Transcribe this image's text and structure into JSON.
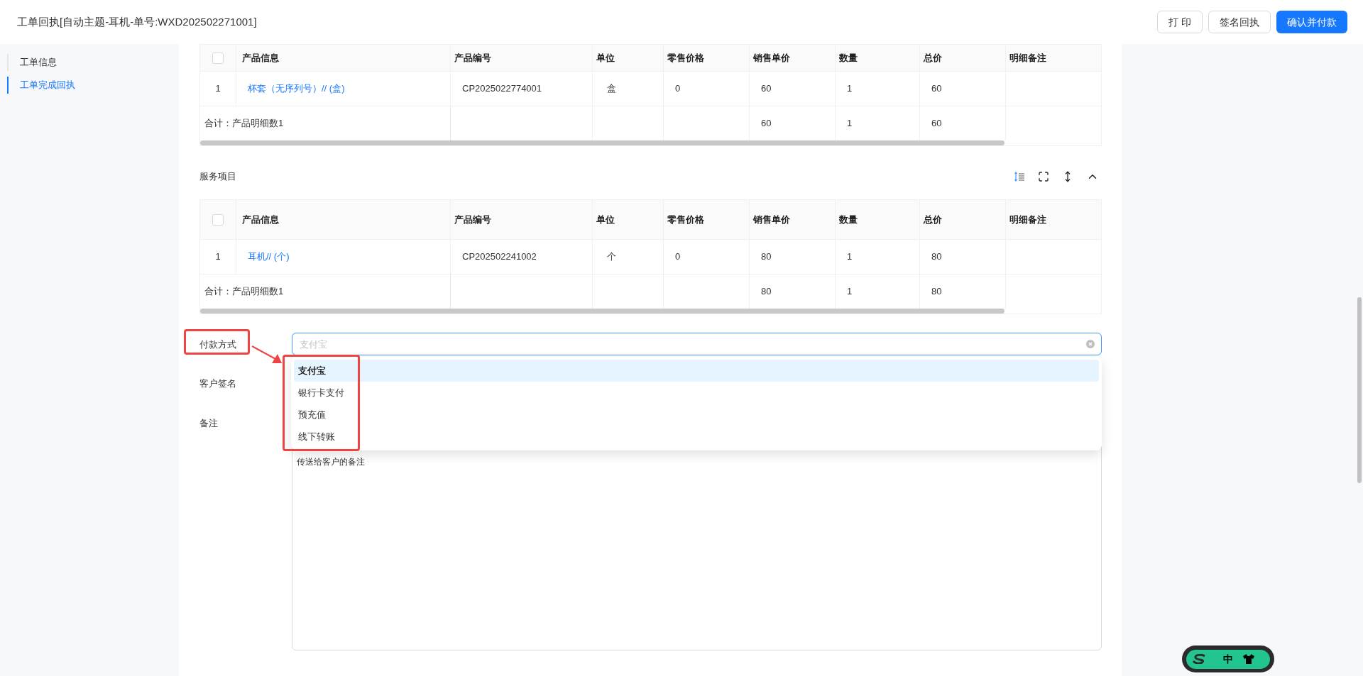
{
  "header": {
    "title": "工单回执[自动主题-耳机-单号:WXD202502271001]",
    "buttons": [
      {
        "label": "打 印",
        "kind": "default"
      },
      {
        "label": "签名回执",
        "kind": "default"
      },
      {
        "label": "确认并付款",
        "kind": "primary"
      }
    ]
  },
  "sidebar": {
    "items": [
      {
        "label": "工单信息",
        "selected": false
      },
      {
        "label": "工单完成回执",
        "selected": true
      }
    ]
  },
  "product_table": {
    "select_all_checked": false,
    "columns": [
      "产品信息",
      "产品编号",
      "单位",
      "零售价格",
      "销售单价",
      "数量",
      "总价",
      "明细备注"
    ],
    "rows": [
      {
        "index": "1",
        "product": "杯套（无序列号）// (盒)",
        "code": "CP2025022774001",
        "unit": "盒",
        "retail_price": "0",
        "sale_price": "60",
        "qty": "1",
        "total": "60"
      }
    ],
    "summary": {
      "label": "合计：产品明细数1",
      "sale_price": "60",
      "qty": "1",
      "total": "60"
    }
  },
  "service_section": {
    "title": "服务项目",
    "table": {
      "select_all_checked": false,
      "columns": [
        "产品信息",
        "产品编号",
        "单位",
        "零售价格",
        "销售单价",
        "数量",
        "总价",
        "明细备注"
      ],
      "rows": [
        {
          "index": "1",
          "product": "耳机// (个)",
          "code": "CP202502241002",
          "unit": "个",
          "retail_price": "0",
          "sale_price": "80",
          "qty": "1",
          "total": "80"
        }
      ],
      "summary": {
        "label": "合计：产品明细数1",
        "sale_price": "80",
        "qty": "1",
        "total": "80"
      }
    }
  },
  "form": {
    "payment": {
      "label": "付款方式",
      "placeholder": "支付宝",
      "options": [
        {
          "label": "支付宝",
          "selected": true
        },
        {
          "label": "银行卡支付",
          "selected": false
        },
        {
          "label": "预充值",
          "selected": false
        },
        {
          "label": "线下转账",
          "selected": false
        }
      ]
    },
    "signature": {
      "label": "客户签名"
    },
    "remark": {
      "label": "备注",
      "value": "传送给客户的备注"
    }
  },
  "ime_badge": {
    "mode": "中"
  }
}
